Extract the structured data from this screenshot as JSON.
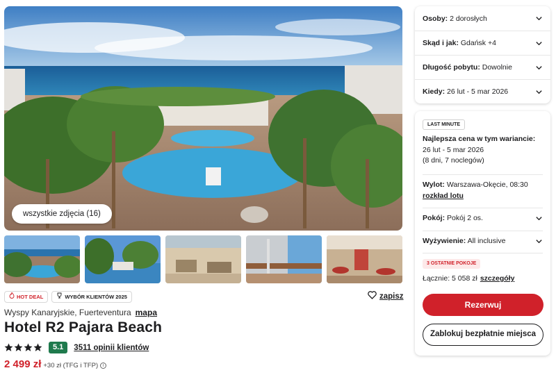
{
  "gallery": {
    "all_photos_label": "wszystkie zdjęcia (16)",
    "thumbnails": [
      "thumb-pool-sea",
      "thumb-gardens",
      "thumb-lounge",
      "thumb-lobby",
      "thumb-restaurant"
    ]
  },
  "badges": {
    "hot_deal": "HOT DEAL",
    "award": "WYBÓR KLIENTÓW 2025"
  },
  "save_label": "zapisz",
  "hotel": {
    "location": "Wyspy Kanaryjskie, Fuerteventura",
    "map_label": "mapa",
    "name": "Hotel R2 Pajara Beach",
    "stars": 4,
    "score": "5.1",
    "reviews": "3511 opinii klientów",
    "price": "2 499 zł",
    "price_extra": "+30 zł (TFG i TFP)"
  },
  "filters": [
    {
      "label": "Osoby:",
      "value": "2 dorosłych"
    },
    {
      "label": "Skąd i jak:",
      "value": "Gdańsk +4"
    },
    {
      "label": "Długość pobytu:",
      "value": "Dowolnie"
    },
    {
      "label": "Kiedy:",
      "value": "26 lut - 5 mar 2026"
    }
  ],
  "offer": {
    "tag": "LAST MINUTE",
    "best_price_title": "Najlepsza cena w tym wariancie:",
    "dates": "26 lut - 5 mar 2026",
    "duration": "(8 dni, 7 noclegów)",
    "flight_label": "Wylot:",
    "flight_value": "Warszawa-Okęcie, 08:30",
    "flight_link": "rozkład lotu",
    "room_label": "Pokój:",
    "room_value": "Pokój 2 os.",
    "board_label": "Wyżywienie:",
    "board_value": "All inclusive",
    "last_rooms": "3 OSTATNIE POKOJE",
    "total_label": "Łącznie: 5 058 zł",
    "details_link": "szczegóły",
    "reserve_button": "Rezerwuj",
    "block_button": "Zablokuj bezpłatnie miejsca"
  },
  "colors": {
    "accent_red": "#d0212a",
    "score_green": "#1f7a4d"
  }
}
